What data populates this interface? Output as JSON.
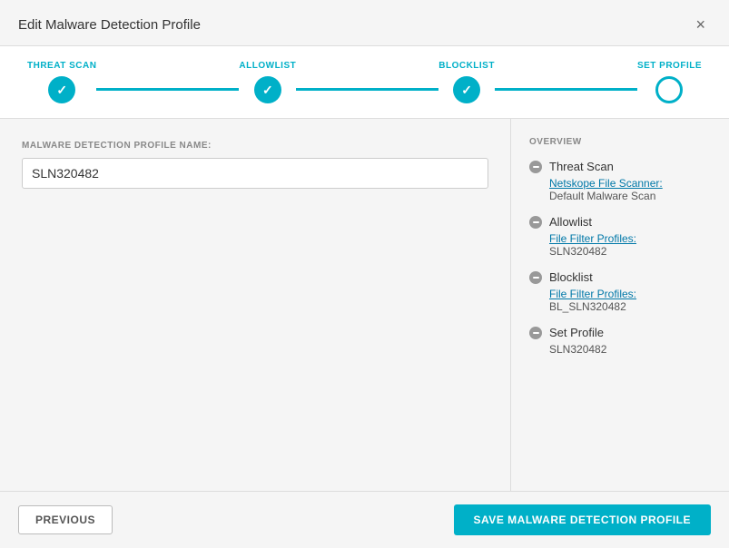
{
  "modal": {
    "title": "Edit Malware Detection Profile",
    "close_label": "×"
  },
  "stepper": {
    "steps": [
      {
        "id": "threat-scan",
        "label": "THREAT SCAN",
        "state": "completed"
      },
      {
        "id": "allowlist",
        "label": "ALLOWLIST",
        "state": "completed"
      },
      {
        "id": "blocklist",
        "label": "BLOCKLIST",
        "state": "completed"
      },
      {
        "id": "set-profile",
        "label": "SET PROFILE",
        "state": "active"
      }
    ]
  },
  "left": {
    "field_label": "MALWARE DETECTION PROFILE NAME:",
    "field_value": "SLN320482",
    "field_placeholder": ""
  },
  "right": {
    "overview_title": "OVERVIEW",
    "sections": [
      {
        "title": "Threat Scan",
        "sub_link": "Netskope File Scanner:",
        "sub_value": "Default Malware Scan"
      },
      {
        "title": "Allowlist",
        "sub_link": "File Filter Profiles:",
        "sub_value": "SLN320482"
      },
      {
        "title": "Blocklist",
        "sub_link": "File Filter Profiles:",
        "sub_value": "BL_SLN320482"
      },
      {
        "title": "Set Profile",
        "sub_link": null,
        "sub_value": "SLN320482"
      }
    ]
  },
  "footer": {
    "previous_label": "PREVIOUS",
    "save_label": "SAVE MALWARE DETECTION PROFILE"
  },
  "colors": {
    "accent": "#00b0c8",
    "completed_bg": "#00b0c8",
    "active_border": "#00b0c8"
  }
}
